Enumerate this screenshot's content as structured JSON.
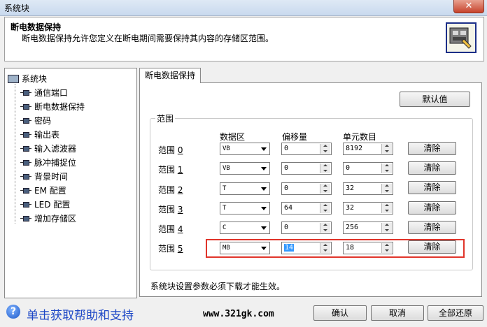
{
  "window": {
    "title": "系统块",
    "close_label": "✕"
  },
  "header": {
    "title": "断电数据保持",
    "description": "断电数据保持允许您定义在断电期间需要保持其内容的存储区范围。",
    "icon": "retentive-memory-icon"
  },
  "tree": {
    "root": "系统块",
    "items": [
      {
        "label": "通信端口"
      },
      {
        "label": "断电数据保持"
      },
      {
        "label": "密码"
      },
      {
        "label": "输出表"
      },
      {
        "label": "输入滤波器"
      },
      {
        "label": "脉冲捕捉位"
      },
      {
        "label": "背景时间"
      },
      {
        "label": "EM 配置"
      },
      {
        "label": "LED 配置"
      },
      {
        "label": "增加存储区"
      }
    ]
  },
  "tab": {
    "label": "断电数据保持"
  },
  "panel": {
    "default_button": "默认值",
    "group_title": "范围",
    "columns": {
      "area": "数据区",
      "offset": "偏移量",
      "count": "单元数目"
    },
    "rows": [
      {
        "label": "范围",
        "index": "0",
        "area": "VB",
        "offset": "0",
        "count": "8192",
        "clear": "清除"
      },
      {
        "label": "范围",
        "index": "1",
        "area": "VB",
        "offset": "0",
        "count": "0",
        "clear": "清除"
      },
      {
        "label": "范围",
        "index": "2",
        "area": "T",
        "offset": "0",
        "count": "32",
        "clear": "清除"
      },
      {
        "label": "范围",
        "index": "3",
        "area": "T",
        "offset": "64",
        "count": "32",
        "clear": "清除"
      },
      {
        "label": "范围",
        "index": "4",
        "area": "C",
        "offset": "0",
        "count": "256",
        "clear": "清除"
      },
      {
        "label": "范围",
        "index": "5",
        "area": "MB",
        "offset": "14",
        "count": "18",
        "clear": "清除"
      }
    ],
    "note": "系统块设置参数必须下载才能生效。"
  },
  "footer": {
    "help_text": "单击获取帮助和支持",
    "watermark": "www.321gk.com",
    "ok": "确认",
    "cancel": "取消",
    "reset": "全部还原"
  }
}
